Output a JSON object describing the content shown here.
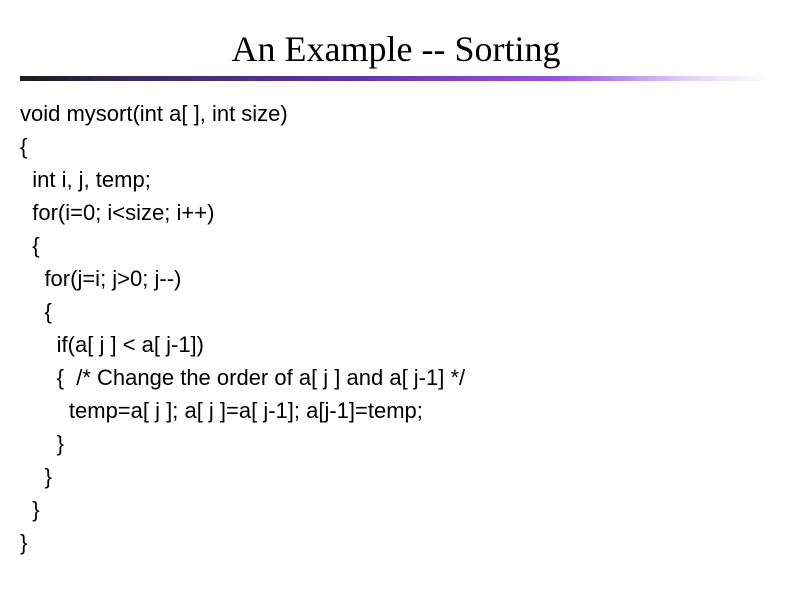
{
  "slide": {
    "title": "An Example -- Sorting",
    "code": "void mysort(int a[ ], int size)\n{\n  int i, j, temp;\n  for(i=0; i<size; i++)\n  {\n    for(j=i; j>0; j--)\n    {\n      if(a[ j ] < a[ j-1])\n      {  /* Change the order of a[ j ] and a[ j-1] */\n        temp=a[ j ]; a[ j ]=a[ j-1]; a[j-1]=temp;\n      }\n    }\n  }\n}"
  }
}
